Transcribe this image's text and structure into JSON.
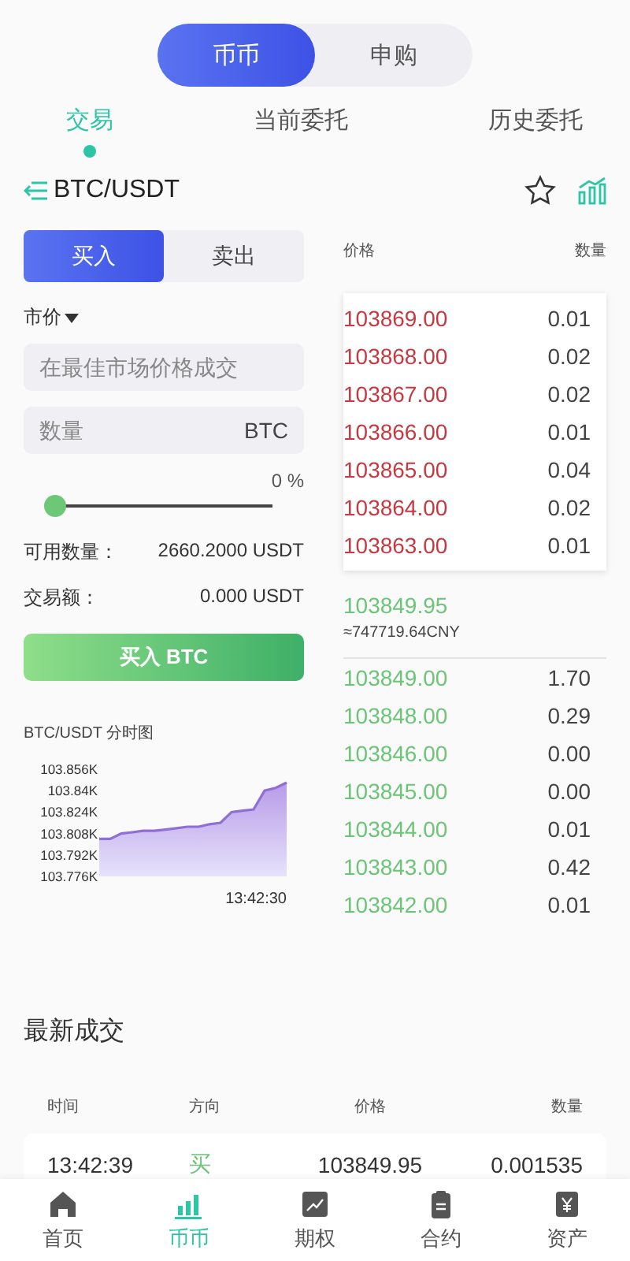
{
  "mode_switch": [
    {
      "label": "币币",
      "selected": true
    },
    {
      "label": "申购",
      "selected": false
    }
  ],
  "tabs": [
    {
      "label": "交易",
      "selected": true
    },
    {
      "label": "当前委托",
      "selected": false
    },
    {
      "label": "历史委托",
      "selected": false
    }
  ],
  "pair": {
    "symbol": "BTC/USDT",
    "favorite": false
  },
  "side_tabs": [
    {
      "label": "买入",
      "selected": true
    },
    {
      "label": "卖出",
      "selected": false
    }
  ],
  "order_type": "市价",
  "price_field": {
    "placeholder": "在最佳市场价格成交"
  },
  "amount_field": {
    "placeholder": "数量",
    "unit": "BTC"
  },
  "slider": {
    "level": 0,
    "reading": "0 %"
  },
  "info": [
    {
      "label": "可用数量：",
      "value": "2660.2000 USDT"
    },
    {
      "label": "交易额：",
      "value": "0.000 USDT"
    }
  ],
  "submit_button": "买入 BTC",
  "chart_title": "BTC/USDT 分时图",
  "chart_time": "13:42:30",
  "chart_data": {
    "type": "area",
    "series": [
      {
        "color": "#8e6fd8",
        "values": [
          103804,
          103804,
          103808,
          103809,
          103810,
          103810,
          103811,
          103812,
          103813,
          103813,
          103815,
          103816,
          103824,
          103825,
          103826,
          103840,
          103842,
          103846
        ]
      }
    ],
    "ylim": [
      103776,
      103856
    ],
    "yticks": [
      {
        "value": 103856,
        "label": "103.856K"
      },
      {
        "value": 103840,
        "label": "103.84K"
      },
      {
        "value": 103824,
        "label": "103.824K"
      },
      {
        "value": 103808,
        "label": "103.808K"
      },
      {
        "value": 103792,
        "label": "103.792K"
      },
      {
        "value": 103776,
        "label": "103.776K"
      }
    ]
  },
  "order_book": {
    "columns": [
      "价格",
      "数量"
    ],
    "asks": [
      {
        "price": "103869.00",
        "amount": "0.01"
      },
      {
        "price": "103868.00",
        "amount": "0.02"
      },
      {
        "price": "103867.00",
        "amount": "0.02"
      },
      {
        "price": "103866.00",
        "amount": "0.01"
      },
      {
        "price": "103865.00",
        "amount": "0.04"
      },
      {
        "price": "103864.00",
        "amount": "0.02"
      },
      {
        "price": "103863.00",
        "amount": "0.01"
      }
    ],
    "last_price": "103849.95",
    "last_price_cny": "≈747719.64CNY",
    "bids": [
      {
        "price": "103849.00",
        "amount": "1.70"
      },
      {
        "price": "103848.00",
        "amount": "0.29"
      },
      {
        "price": "103846.00",
        "amount": "0.00"
      },
      {
        "price": "103845.00",
        "amount": "0.00"
      },
      {
        "price": "103844.00",
        "amount": "0.01"
      },
      {
        "price": "103843.00",
        "amount": "0.42"
      },
      {
        "price": "103842.00",
        "amount": "0.01"
      }
    ]
  },
  "recent_trades": {
    "title": "最新成交",
    "columns": [
      "时间",
      "方向",
      "价格",
      "数量"
    ],
    "rows": [
      {
        "time": "13:42:39",
        "side": "买",
        "kind": "buy",
        "price": "103849.95",
        "amount": "0.001535"
      }
    ]
  },
  "bottom_nav": [
    {
      "label": "首页",
      "kind": "home",
      "selected": false
    },
    {
      "label": "币币",
      "kind": "bars",
      "selected": true
    },
    {
      "label": "期权",
      "kind": "chart",
      "selected": false
    },
    {
      "label": "合约",
      "kind": "clipboard",
      "selected": false
    },
    {
      "label": "资产",
      "kind": "wallet",
      "selected": false
    }
  ]
}
